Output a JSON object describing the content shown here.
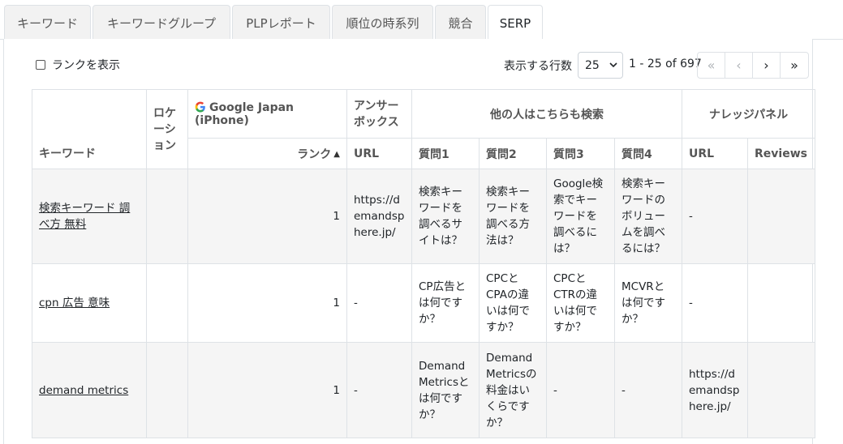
{
  "tabs": [
    {
      "label": "キーワード",
      "active": false
    },
    {
      "label": "キーワードグループ",
      "active": false
    },
    {
      "label": "PLPレポート",
      "active": false
    },
    {
      "label": "順位の時系列",
      "active": false
    },
    {
      "label": "競合",
      "active": false
    },
    {
      "label": "SERP",
      "active": true
    }
  ],
  "controls": {
    "show_rank_label": "ランクを表示",
    "show_rank_checked": false,
    "rows_label": "表示する行数",
    "rows_value": "25",
    "range_text": "1 - 25 of 697",
    "pager": {
      "first": "«",
      "prev": "‹",
      "next": "›",
      "last": "»"
    }
  },
  "table": {
    "headers": {
      "keyword": "キーワード",
      "location": "ロケーション",
      "engine": "Google Japan (iPhone)",
      "rank": "ランク",
      "answer_box": "アンサーボックス",
      "paa": "他の人はこちらも検索",
      "knowledge_panel": "ナレッジパネル",
      "url": "URL",
      "q1": "質問1",
      "q2": "質問2",
      "q3": "質問3",
      "q4": "質問4",
      "kp_url": "URL",
      "reviews": "Reviews"
    },
    "rows": [
      {
        "keyword": "検索キーワード 調べ方 無料",
        "location": "",
        "rank": "1",
        "answer_url": "https://demandsphere.jp/",
        "q1": "検索キーワードを調べるサイトは？",
        "q2": "検索キーワードを調べる方法は？",
        "q3": "Google検索でキーワードを調べるには？",
        "q4": "検索キーワードのボリュームを調べるには？",
        "kp_url": "-",
        "reviews": ""
      },
      {
        "keyword": "cpn 広告 意味",
        "location": "",
        "rank": "1",
        "answer_url": "-",
        "q1": "CP広告とは何ですか？",
        "q2": "CPCとCPAの違いは何ですか？",
        "q3": "CPCとCTRの違いは何ですか？",
        "q4": "MCVRとは何ですか？",
        "kp_url": "-",
        "reviews": ""
      },
      {
        "keyword": "demand metrics",
        "location": "",
        "rank": "1",
        "answer_url": "-",
        "q1": "Demand Metricsとは何ですか？",
        "q2": "Demand Metricsの料金はいくらですか？",
        "q3": "-",
        "q4": "-",
        "kp_url": "https://demandsphere.jp/",
        "reviews": ""
      }
    ]
  },
  "colors": {
    "border": "#dee2e6",
    "tab_bg": "#f2f2f2",
    "row_stripe": "#f5f5f5",
    "google_blue": "#4285F4",
    "google_red": "#EA4335",
    "google_yellow": "#FBBC05",
    "google_green": "#34A853"
  }
}
